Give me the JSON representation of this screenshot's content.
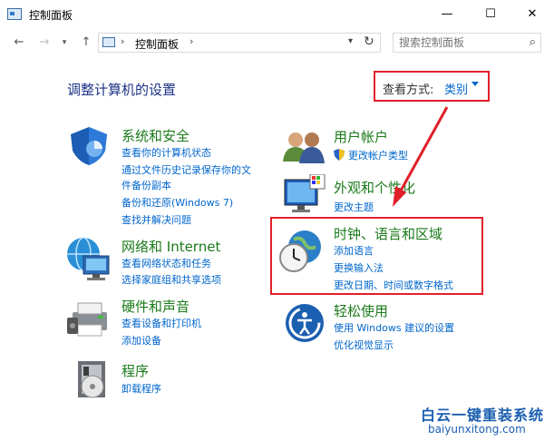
{
  "window": {
    "title": "控制面板"
  },
  "nav": {
    "address_crumb": "控制面板",
    "search_placeholder": "搜索控制面板"
  },
  "main": {
    "heading": "调整计算机的设置",
    "view_label": "查看方式:",
    "view_value": "类别"
  },
  "categories": [
    {
      "title": "系统和安全",
      "links": [
        "查看你的计算机状态",
        "通过文件历史记录保存你的文",
        "件备份副本",
        "备份和还原(Windows 7)",
        "查找并解决问题"
      ]
    },
    {
      "title": "网络和 Internet",
      "links": [
        "查看网络状态和任务",
        "选择家庭组和共享选项"
      ]
    },
    {
      "title": "硬件和声音",
      "links": [
        "查看设备和打印机",
        "添加设备"
      ]
    },
    {
      "title": "程序",
      "links": [
        "卸载程序"
      ]
    },
    {
      "title": "用户帐户",
      "links": [
        "更改帐户类型"
      ]
    },
    {
      "title": "外观和个性化",
      "links": [
        "更改主题"
      ]
    },
    {
      "title": "时钟、语言和区域",
      "links": [
        "添加语言",
        "更换输入法",
        "更改日期、时间或数字格式"
      ]
    },
    {
      "title": "轻松使用",
      "links": [
        "使用 Windows 建议的设置",
        "优化视觉显示"
      ]
    }
  ],
  "watermark": {
    "cn": "白云一键重装系统",
    "en": "baiyunxitong.com"
  },
  "colors": {
    "accent_red": "#e0202a",
    "link_blue": "#0066cc",
    "category_green": "#1a7a1a",
    "heading_blue": "#1e3287"
  }
}
